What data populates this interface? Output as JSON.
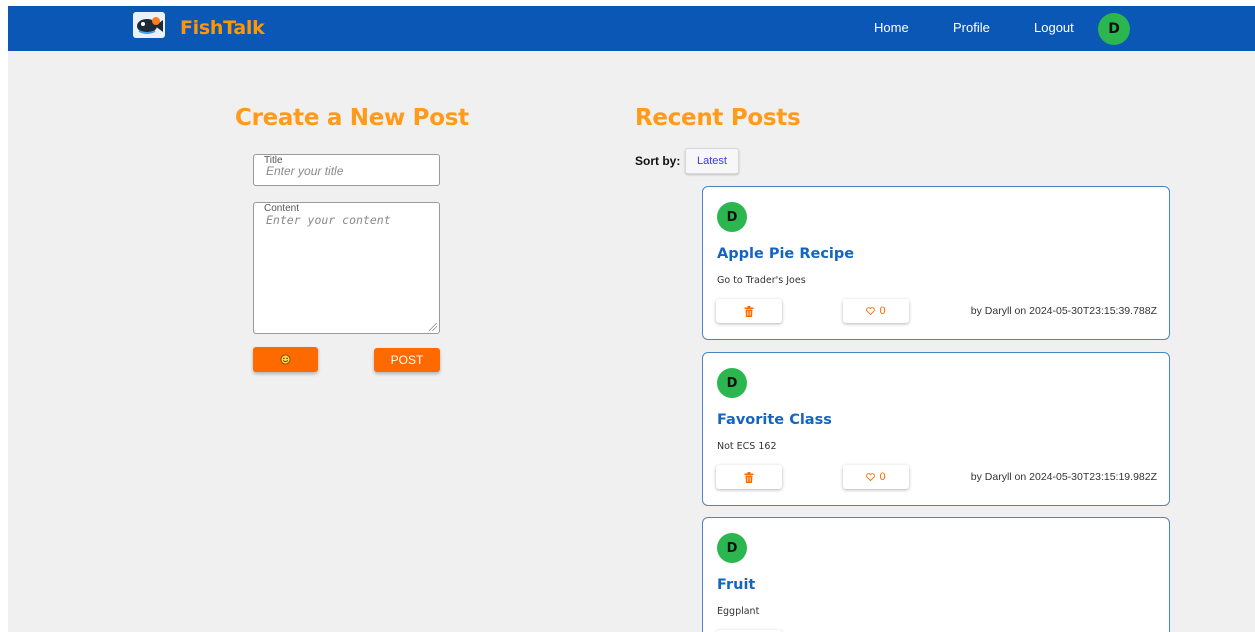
{
  "header": {
    "brand": "FishTalk",
    "nav": {
      "home": "Home",
      "profile": "Profile",
      "logout": "Logout"
    },
    "user_initial": "D",
    "colors": {
      "bar": "#0b57b5",
      "brand": "#ff9800",
      "avatar": "#2bb650"
    }
  },
  "create": {
    "heading": "Create a New Post",
    "title_label": "Title",
    "title_placeholder": "Enter your title",
    "content_label": "Content",
    "content_placeholder": "Enter your content",
    "emoji_icon": "smiley-icon",
    "post_label": "POST"
  },
  "recent": {
    "heading": "Recent Posts",
    "sort_label": "Sort by:",
    "sort_value": "Latest",
    "posts": [
      {
        "initial": "D",
        "title": "Apple Pie Recipe",
        "content": "Go to Trader's Joes",
        "likes": "0",
        "meta": "by Daryll on 2024-05-30T23:15:39.788Z"
      },
      {
        "initial": "D",
        "title": "Favorite Class",
        "content": "Not ECS 162",
        "likes": "0",
        "meta": "by Daryll on 2024-05-30T23:15:19.982Z"
      },
      {
        "initial": "D",
        "title": "Fruit",
        "content": "Eggplant",
        "likes": "",
        "meta": ""
      }
    ]
  }
}
